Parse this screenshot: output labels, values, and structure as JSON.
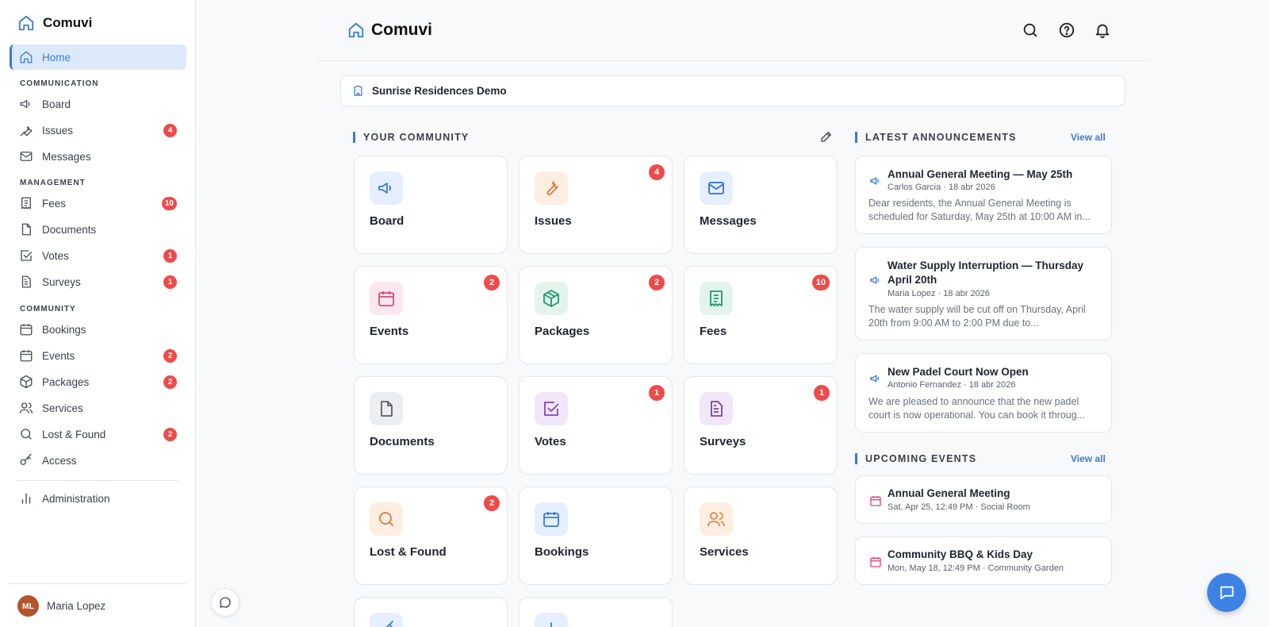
{
  "app": {
    "name": "Comuvi"
  },
  "sidebar": {
    "home": {
      "label": "Home"
    },
    "sections": {
      "communication": "COMMUNICATION",
      "management": "MANAGEMENT",
      "community": "COMMUNITY"
    },
    "items": {
      "board": {
        "label": "Board"
      },
      "issues": {
        "label": "Issues",
        "badge": "4"
      },
      "messages": {
        "label": "Messages"
      },
      "fees": {
        "label": "Fees",
        "badge": "10"
      },
      "documents": {
        "label": "Documents"
      },
      "votes": {
        "label": "Votes",
        "badge": "1"
      },
      "surveys": {
        "label": "Surveys",
        "badge": "1"
      },
      "bookings": {
        "label": "Bookings"
      },
      "events": {
        "label": "Events",
        "badge": "2"
      },
      "packages": {
        "label": "Packages",
        "badge": "2"
      },
      "services": {
        "label": "Services"
      },
      "lost_found": {
        "label": "Lost & Found",
        "badge": "2"
      },
      "access": {
        "label": "Access"
      },
      "administration": {
        "label": "Administration"
      }
    },
    "user": {
      "initials": "ML",
      "name": "Maria Lopez"
    }
  },
  "header": {
    "brand": "Comuvi"
  },
  "community": {
    "name": "Sunrise Residences Demo"
  },
  "your_community": {
    "title": "YOUR COMMUNITY",
    "tiles": {
      "board": {
        "label": "Board"
      },
      "issues": {
        "label": "Issues",
        "badge": "4"
      },
      "messages": {
        "label": "Messages"
      },
      "events": {
        "label": "Events",
        "badge": "2"
      },
      "packages": {
        "label": "Packages",
        "badge": "2"
      },
      "fees": {
        "label": "Fees",
        "badge": "10"
      },
      "documents": {
        "label": "Documents"
      },
      "votes": {
        "label": "Votes",
        "badge": "1"
      },
      "surveys": {
        "label": "Surveys",
        "badge": "1"
      },
      "lost_found": {
        "label": "Lost & Found",
        "badge": "2"
      },
      "bookings": {
        "label": "Bookings"
      },
      "services": {
        "label": "Services"
      }
    }
  },
  "announcements": {
    "title": "LATEST ANNOUNCEMENTS",
    "view_all": "View all",
    "items": [
      {
        "title": "Annual General Meeting — May 25th",
        "meta": "Carlos Garcia · 18 abr 2026",
        "body": "Dear residents, the Annual General Meeting is scheduled for Saturday, May 25th at 10:00 AM in..."
      },
      {
        "title": "Water Supply Interruption — Thursday April 20th",
        "meta": "Maria Lopez · 18 abr 2026",
        "body": "The water supply will be cut off on Thursday, April 20th from 9:00 AM to 2:00 PM due to..."
      },
      {
        "title": "New Padel Court Now Open",
        "meta": "Antonio Fernandez · 18 abr 2026",
        "body": "We are pleased to announce that the new padel court is now operational. You can book it throug..."
      }
    ]
  },
  "events": {
    "title": "UPCOMING EVENTS",
    "view_all": "View all",
    "items": [
      {
        "title": "Annual General Meeting",
        "meta": "Sat, Apr 25, 12:49 PM · Social Room"
      },
      {
        "title": "Community BBQ & Kids Day",
        "meta": "Mon, May 18, 12:49 PM · Community Garden"
      }
    ]
  },
  "colors": {
    "accent": "#3a7bd5",
    "badge": "#ef4a4a",
    "board_bg": "#e6efff",
    "board_fg": "#3a7bd5",
    "issues_bg": "#fdeee2",
    "issues_fg": "#e07a3a",
    "messages_bg": "#e6efff",
    "messages_fg": "#2f6fd0",
    "events_bg": "#fde7ee",
    "events_fg": "#e0457b",
    "packages_bg": "#e3f4ec",
    "packages_fg": "#1f9a6b",
    "fees_bg": "#e3f4ec",
    "fees_fg": "#1f9a6b",
    "documents_bg": "#eceef2",
    "documents_fg": "#5a606b",
    "votes_bg": "#f0e8f8",
    "votes_fg": "#8a3fc4",
    "surveys_bg": "#f0e8f8",
    "surveys_fg": "#7a3fb4",
    "lost_bg": "#fdeee2",
    "lost_fg": "#e07a3a",
    "bookings_bg": "#e6efff",
    "bookings_fg": "#3a7bd5",
    "services_bg": "#fdeee2",
    "services_fg": "#e08a4a"
  }
}
